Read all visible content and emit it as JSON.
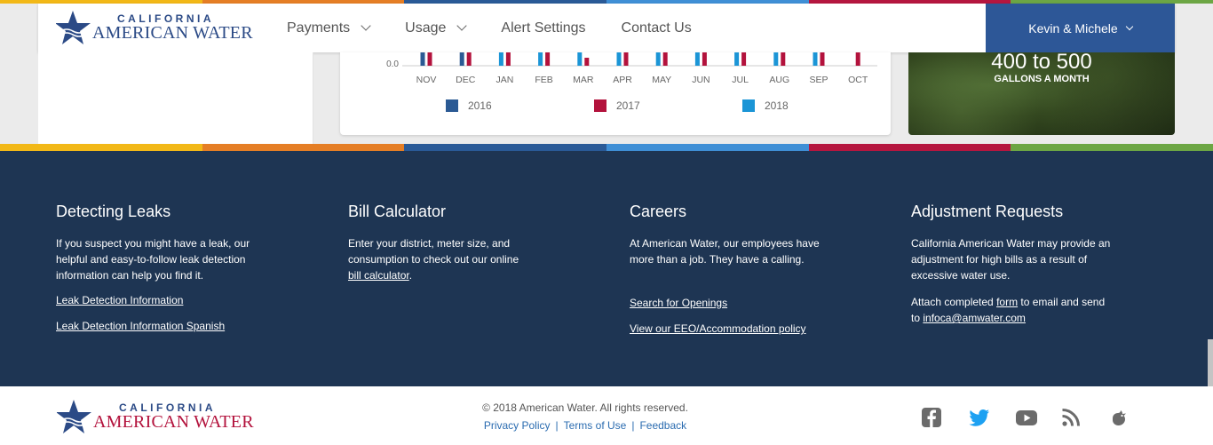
{
  "brand": {
    "line1": "CALIFORNIA",
    "line2": "AMERICAN WATER"
  },
  "nav": {
    "payments": "Payments",
    "usage": "Usage",
    "alert_settings": "Alert Settings",
    "contact_us": "Contact Us",
    "user": "Kevin & Michele"
  },
  "colors": {
    "stripe": [
      "#f2b817",
      "#e57e25",
      "#2a5a97",
      "#3f8fd6",
      "#b5163f",
      "#6ca644"
    ],
    "series_2016": "#2b5a94",
    "series_2017": "#b3123c",
    "series_2018": "#1b95d6",
    "footer_bg": "#1e3553",
    "header_user_bg": "#2d5797"
  },
  "chart_data": {
    "type": "bar",
    "categories": [
      "NOV",
      "DEC",
      "JAN",
      "FEB",
      "MAR",
      "APR",
      "MAY",
      "JUN",
      "JUL",
      "AUG",
      "SEP",
      "OCT"
    ],
    "series": [
      {
        "name": "2016",
        "values": [
          1,
          1,
          null,
          null,
          null,
          null,
          null,
          null,
          null,
          null,
          null,
          null
        ]
      },
      {
        "name": "2017",
        "values": [
          1,
          1,
          1,
          1,
          0.15,
          1,
          1,
          1,
          1,
          1,
          1,
          1
        ]
      },
      {
        "name": "2018",
        "values": [
          null,
          null,
          1,
          1,
          1,
          1,
          1,
          1,
          1,
          1,
          1,
          null
        ]
      }
    ],
    "y_tick_visible": "0.0",
    "legend_position": "bottom"
  },
  "promo": {
    "value": "400 to 500",
    "unit": "GALLONS A MONTH"
  },
  "footer": {
    "leaks": {
      "title": "Detecting Leaks",
      "text": "If you suspect you might have a leak, our helpful and easy-to-follow leak detection information can help you find it.",
      "link1": "Leak Detection Information",
      "link2": "Leak Detection Information Spanish"
    },
    "calculator": {
      "title": "Bill Calculator",
      "text": "Enter your district, meter size, and consumption to check out our online",
      "link": "bill calculator",
      "after": "."
    },
    "careers": {
      "title": "Careers",
      "text": "At American Water, our employees have more than a job. They have a calling.",
      "link1": "Search for Openings",
      "link2": "View our EEO/Accommodation policy"
    },
    "adjustment": {
      "title": "Adjustment Requests",
      "text": "California American Water may provide an adjustment for high bills as a result of excessive water use.",
      "attach_before": "Attach completed",
      "form_link": "form",
      "attach_after": "to email and send to",
      "email_link": "infoca@amwater.com"
    }
  },
  "bottom": {
    "copyright": "© 2018 American Water. All rights reserved.",
    "privacy": "Privacy Policy",
    "sep": "|",
    "terms": "Terms of Use",
    "feedback": "Feedback"
  }
}
